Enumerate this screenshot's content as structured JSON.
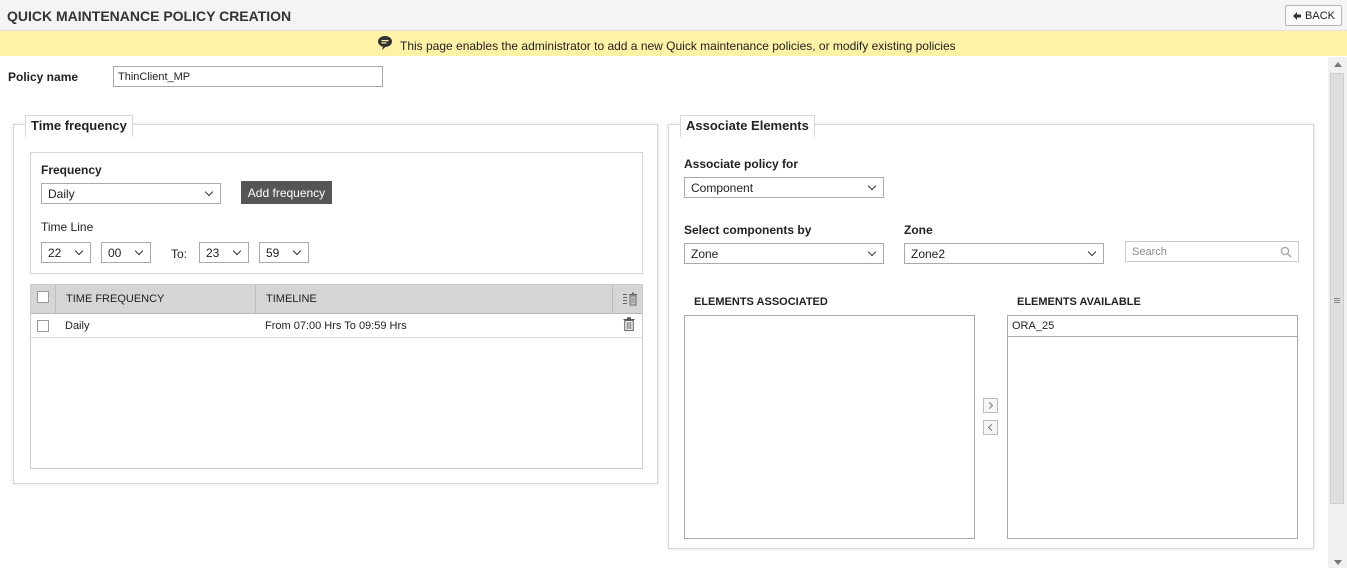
{
  "header": {
    "title": "QUICK MAINTENANCE POLICY CREATION",
    "back_label": "BACK"
  },
  "info": {
    "message": "This page enables the administrator to add a new Quick maintenance policies, or modify existing policies"
  },
  "policy": {
    "label": "Policy name",
    "value": "ThinClient_MP"
  },
  "time_frequency": {
    "legend": "Time frequency",
    "frequency_label": "Frequency",
    "frequency_value": "Daily",
    "add_button": "Add frequency",
    "timeline_label": "Time Line",
    "from_hour": "22",
    "from_minute": "00",
    "to_label": "To:",
    "to_hour": "23",
    "to_minute": "59",
    "table": {
      "headers": [
        "TIME FREQUENCY",
        "TIMELINE"
      ],
      "rows": [
        {
          "frequency": "Daily",
          "timeline": "From 07:00 Hrs To 09:59 Hrs"
        }
      ]
    }
  },
  "associate": {
    "legend": "Associate Elements",
    "policy_for_label": "Associate policy for",
    "policy_for_value": "Component",
    "select_by_label": "Select components by",
    "select_by_value": "Zone",
    "zone_label": "Zone",
    "zone_value": "Zone2",
    "search_placeholder": "Search",
    "associated_label": "ELEMENTS ASSOCIATED",
    "available_label": "ELEMENTS AVAILABLE",
    "available_items": [
      "ORA_25"
    ]
  },
  "colors": {
    "info_bar": "#fdf3a7",
    "add_button": "#555555",
    "table_header": "#d5d5d5"
  }
}
